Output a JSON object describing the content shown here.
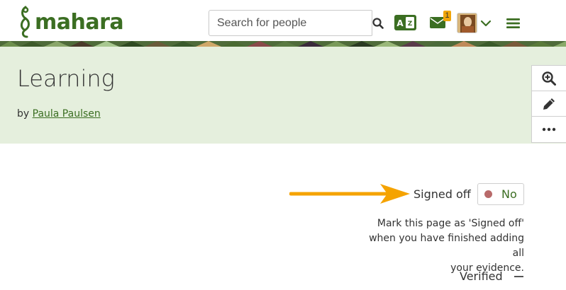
{
  "header": {
    "logo_text": "mahara",
    "search_placeholder": "Search for people",
    "icons": {
      "search": "search-icon",
      "language": "language-icon",
      "messages": "envelope-icon",
      "user_menu": "chevron-down-icon",
      "main_menu": "hamburger-icon"
    },
    "unread_count": "1"
  },
  "page": {
    "title": "Learning",
    "by_prefix": "by",
    "author": "Paula Paulsen"
  },
  "side_tools": [
    {
      "name": "zoom-in-icon"
    },
    {
      "name": "pencil-icon"
    },
    {
      "name": "more-icon"
    }
  ],
  "signoff": {
    "label": "Signed off",
    "value": "No",
    "help_line1": "Mark this page as 'Signed off'",
    "help_line2": "when you have finished adding all",
    "help_line3": "your evidence.",
    "verified_label": "Verified"
  },
  "colors": {
    "brand_green": "#3b6e22",
    "header_bg": "#e5efdd",
    "arrow": "#f5a300",
    "badge": "#f0a50a",
    "status_dot": "#b86a6a"
  }
}
